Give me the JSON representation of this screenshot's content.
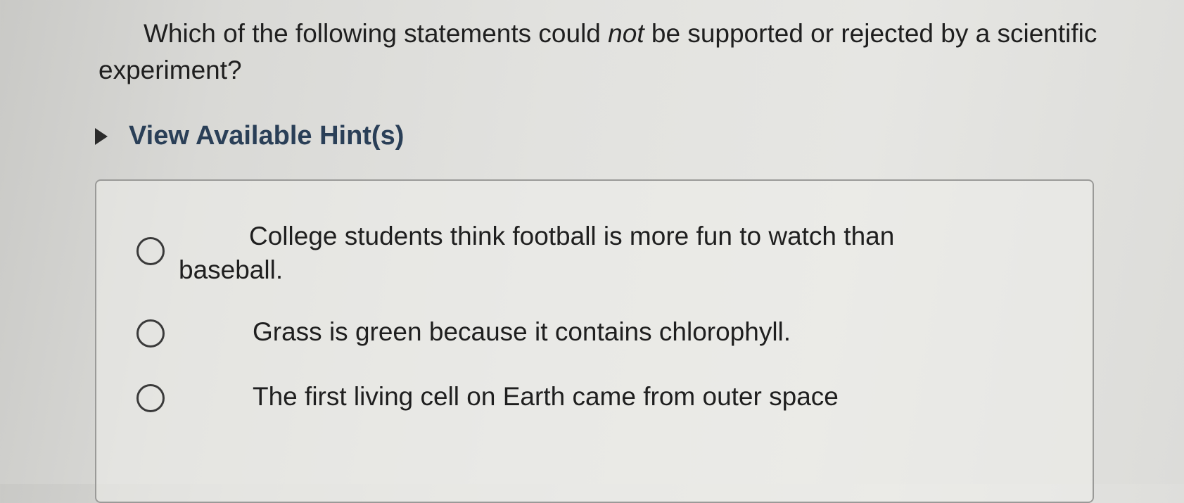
{
  "question": {
    "part1": "Which of the following statements could ",
    "emphasis": "not",
    "part2": " be supported or rejected by a scientific experiment?"
  },
  "hints": {
    "label": "View Available Hint(s)",
    "icon": "triangle-right-icon"
  },
  "options": [
    {
      "label": "College students think football is more fun to watch than baseball.",
      "selected": false
    },
    {
      "label": "Grass is green because it contains chlorophyll.",
      "selected": false
    },
    {
      "label": "The first living cell on Earth came from outer space",
      "selected": false
    }
  ]
}
